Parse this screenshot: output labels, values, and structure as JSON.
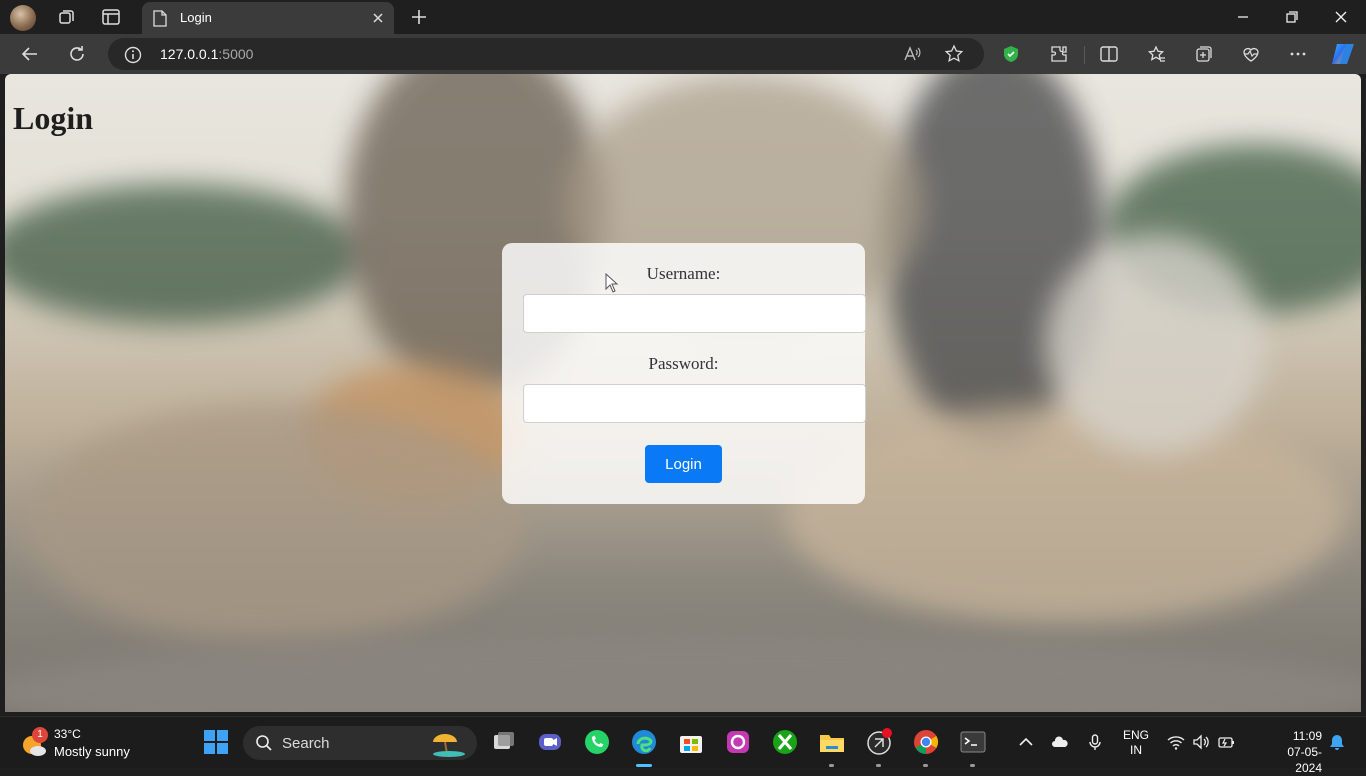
{
  "browser": {
    "tab_title": "Login",
    "url_host": "127.0.0.1",
    "url_port": ":5000"
  },
  "page": {
    "heading": "Login",
    "username_label": "Username:",
    "username_value": "",
    "password_label": "Password:",
    "password_value": "",
    "login_button": "Login"
  },
  "taskbar": {
    "weather_temp": "33°C",
    "weather_condition": "Mostly sunny",
    "weather_badge": "1",
    "search_label": "Search",
    "lang_line1": "ENG",
    "lang_line2": "IN",
    "time": "11:09",
    "date": "07-05-2024"
  },
  "colors": {
    "accent": "#0a79f5",
    "browser_chrome": "#3b3b3b",
    "taskbar": "#1c1c1c"
  }
}
